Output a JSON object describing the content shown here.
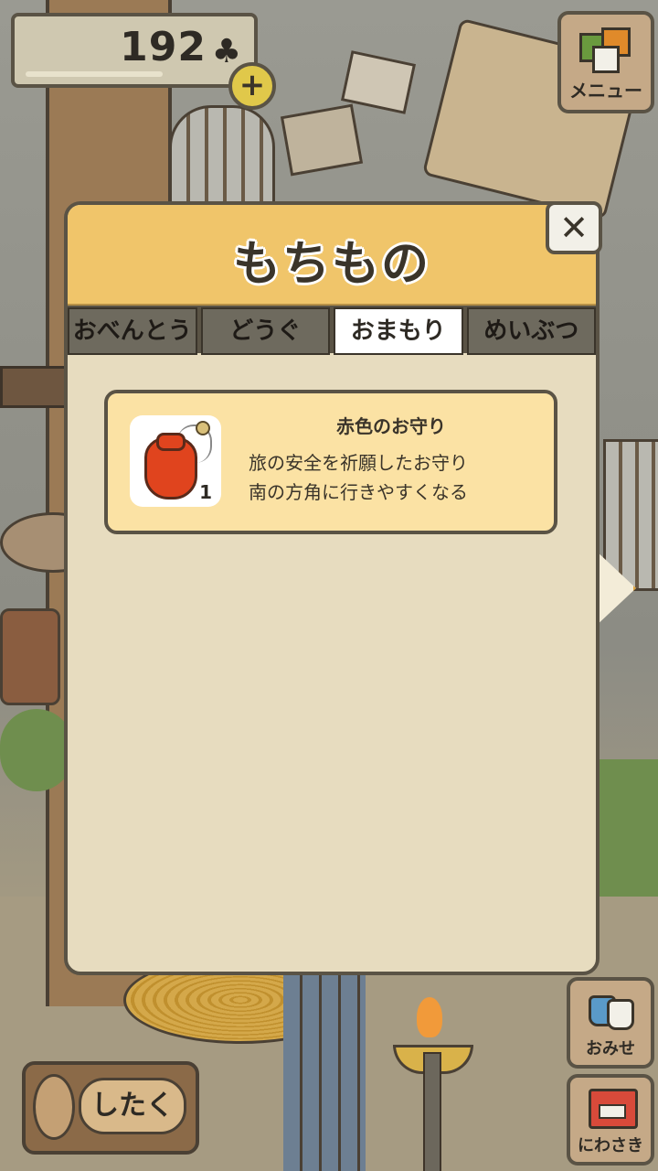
{
  "hud": {
    "coins": "192",
    "coin_symbol": "♣",
    "plus": "+",
    "menu_label": "メニュー",
    "shop_label": "おみせ",
    "garden_label": "にわさき",
    "prepare_label": "したく"
  },
  "modal": {
    "title": "もちもの",
    "close": "✕",
    "tabs": [
      {
        "label": "おべんとう",
        "active": false
      },
      {
        "label": "どうぐ",
        "active": false
      },
      {
        "label": "おまもり",
        "active": true
      },
      {
        "label": "めいぶつ",
        "active": false
      }
    ],
    "items": [
      {
        "name": "赤色のお守り",
        "count": "1",
        "desc_line1": "旅の安全を祈願したお守り",
        "desc_line2": "南の方角に行きやすくなる",
        "icon": "red-charm-pouch-icon"
      }
    ]
  },
  "colors": {
    "header": "#f0c56a",
    "panel": "#e7dcbf",
    "card": "#fbe2a4",
    "border": "#5a5345",
    "charm": "#e0441e"
  }
}
